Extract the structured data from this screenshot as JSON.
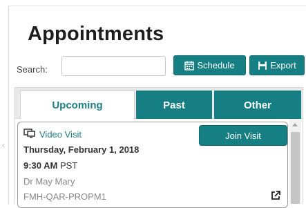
{
  "page": {
    "title": "Appointments"
  },
  "search": {
    "label": "Search:",
    "value": "",
    "placeholder": ""
  },
  "toolbar": {
    "schedule_label": "Schedule",
    "schedule_icon": "calendar-icon",
    "export_label": "Export",
    "export_icon": "save-icon"
  },
  "tabs": [
    {
      "label": "Upcoming",
      "active": true
    },
    {
      "label": "Past",
      "active": false
    },
    {
      "label": "Other",
      "active": false
    }
  ],
  "appointments": [
    {
      "visit_type": "Video Visit",
      "visit_icon": "video-visit-icon",
      "join_label": "Join Visit",
      "date": "Thursday, February 1, 2018",
      "time": "9:30 AM",
      "timezone": "PST",
      "doctor": "Dr May Mary",
      "location": "FMH-QAR-PROPM1",
      "link_icon": "external-link-icon"
    }
  ],
  "colors": {
    "accent": "#167f83",
    "accent_text": "#1f7f86",
    "muted_text": "#888888"
  }
}
